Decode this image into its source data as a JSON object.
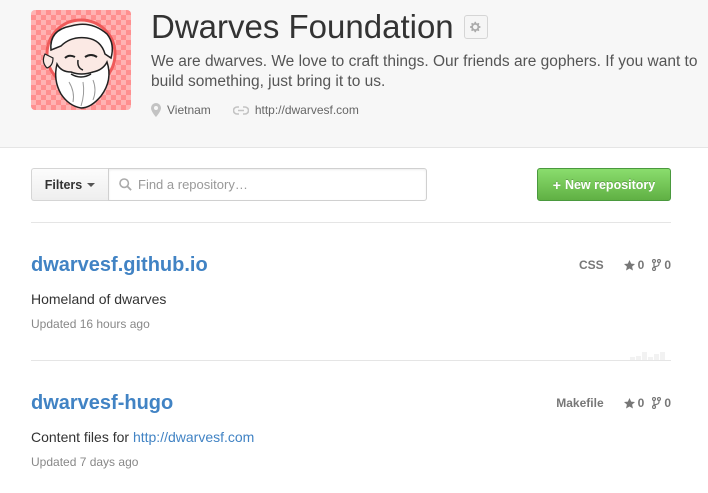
{
  "org": {
    "name": "Dwarves Foundation",
    "description": "We are dwarves. We love to craft things. Our friends are gophers. If you want to build something, just bring it to us.",
    "location": "Vietnam",
    "website": "http://dwarvesf.com"
  },
  "toolbar": {
    "filters_label": "Filters",
    "search_placeholder": "Find a repository…",
    "new_repo_label": "New repository"
  },
  "repos": [
    {
      "name": "dwarvesf.github.io",
      "language": "CSS",
      "stars": "0",
      "forks": "0",
      "description": "Homeland of dwarves",
      "updated": "Updated 16 hours ago"
    },
    {
      "name": "dwarvesf-hugo",
      "language": "Makefile",
      "stars": "0",
      "forks": "0",
      "description_prefix": "Content files for",
      "description_link": "http://dwarvesf.com",
      "updated": "Updated 7 days ago"
    }
  ],
  "icons": {
    "settings": "gear-icon",
    "location": "location-pin-icon",
    "website": "link-icon",
    "search": "search-icon",
    "star": "star-icon",
    "fork": "fork-icon"
  },
  "colors": {
    "link": "#4183c4",
    "new_repo_button": "#60b044",
    "header_bg": "#f7f7f7"
  }
}
